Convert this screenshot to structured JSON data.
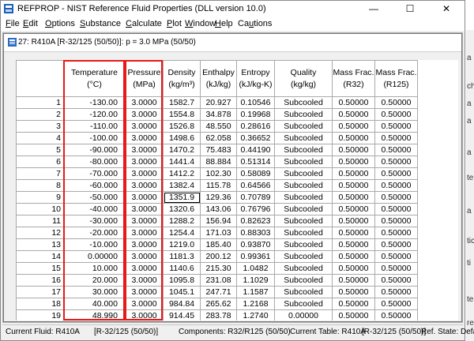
{
  "app": {
    "title": "REFPROP - NIST Reference Fluid Properties (DLL version 10.0)",
    "window_controls": {
      "minimize": "—",
      "maximize": "☐",
      "close": "✕"
    }
  },
  "menu": [
    {
      "pre": "",
      "key": "F",
      "post": "ile"
    },
    {
      "pre": "",
      "key": "E",
      "post": "dit"
    },
    {
      "pre": "",
      "key": "O",
      "post": "ptions"
    },
    {
      "pre": "",
      "key": "S",
      "post": "ubstance"
    },
    {
      "pre": "",
      "key": "C",
      "post": "alculate"
    },
    {
      "pre": "",
      "key": "P",
      "post": "lot"
    },
    {
      "pre": "",
      "key": "W",
      "post": "indow"
    },
    {
      "pre": "",
      "key": "H",
      "post": "elp"
    },
    {
      "pre": "Ca",
      "key": "u",
      "post": "tions"
    }
  ],
  "child_window": {
    "title": "27: R410A   [R-32/125 (50/50)]: p = 3.0 MPa (50/50)"
  },
  "table": {
    "columns": [
      {
        "line1": "Temperature",
        "line2": "(°C)"
      },
      {
        "line1": "Pressure",
        "line2": "(MPa)"
      },
      {
        "line1": "Density",
        "line2": "(kg/m³)"
      },
      {
        "line1": "Enthalpy",
        "line2": "(kJ/kg)"
      },
      {
        "line1": "Entropy",
        "line2": "(kJ/kg-K)"
      },
      {
        "line1": "Quality",
        "line2": "(kg/kg)"
      },
      {
        "line1": "Mass Frac.",
        "line2": "(R32)"
      },
      {
        "line1": "Mass Frac.",
        "line2": "(R125)"
      }
    ],
    "rows": [
      [
        "1",
        "-130.00",
        "3.0000",
        "1582.7",
        "20.927",
        "0.10546",
        "Subcooled",
        "0.50000",
        "0.50000"
      ],
      [
        "2",
        "-120.00",
        "3.0000",
        "1554.8",
        "34.878",
        "0.19968",
        "Subcooled",
        "0.50000",
        "0.50000"
      ],
      [
        "3",
        "-110.00",
        "3.0000",
        "1526.8",
        "48.550",
        "0.28616",
        "Subcooled",
        "0.50000",
        "0.50000"
      ],
      [
        "4",
        "-100.00",
        "3.0000",
        "1498.6",
        "62.058",
        "0.36652",
        "Subcooled",
        "0.50000",
        "0.50000"
      ],
      [
        "5",
        "-90.000",
        "3.0000",
        "1470.2",
        "75.483",
        "0.44190",
        "Subcooled",
        "0.50000",
        "0.50000"
      ],
      [
        "6",
        "-80.000",
        "3.0000",
        "1441.4",
        "88.884",
        "0.51314",
        "Subcooled",
        "0.50000",
        "0.50000"
      ],
      [
        "7",
        "-70.000",
        "3.0000",
        "1412.2",
        "102.30",
        "0.58089",
        "Subcooled",
        "0.50000",
        "0.50000"
      ],
      [
        "8",
        "-60.000",
        "3.0000",
        "1382.4",
        "115.78",
        "0.64566",
        "Subcooled",
        "0.50000",
        "0.50000"
      ],
      [
        "9",
        "-50.000",
        "3.0000",
        "1351.9",
        "129.36",
        "0.70789",
        "Subcooled",
        "0.50000",
        "0.50000"
      ],
      [
        "10",
        "-40.000",
        "3.0000",
        "1320.6",
        "143.06",
        "0.76796",
        "Subcooled",
        "0.50000",
        "0.50000"
      ],
      [
        "11",
        "-30.000",
        "3.0000",
        "1288.2",
        "156.94",
        "0.82623",
        "Subcooled",
        "0.50000",
        "0.50000"
      ],
      [
        "12",
        "-20.000",
        "3.0000",
        "1254.4",
        "171.03",
        "0.88303",
        "Subcooled",
        "0.50000",
        "0.50000"
      ],
      [
        "13",
        "-10.000",
        "3.0000",
        "1219.0",
        "185.40",
        "0.93870",
        "Subcooled",
        "0.50000",
        "0.50000"
      ],
      [
        "14",
        "0.00000",
        "3.0000",
        "1181.3",
        "200.12",
        "0.99361",
        "Subcooled",
        "0.50000",
        "0.50000"
      ],
      [
        "15",
        "10.000",
        "3.0000",
        "1140.6",
        "215.30",
        "1.0482",
        "Subcooled",
        "0.50000",
        "0.50000"
      ],
      [
        "16",
        "20.000",
        "3.0000",
        "1095.8",
        "231.08",
        "1.1029",
        "Subcooled",
        "0.50000",
        "0.50000"
      ],
      [
        "17",
        "30.000",
        "3.0000",
        "1045.1",
        "247.71",
        "1.1587",
        "Subcooled",
        "0.50000",
        "0.50000"
      ],
      [
        "18",
        "40.000",
        "3.0000",
        "984.84",
        "265.62",
        "1.2168",
        "Subcooled",
        "0.50000",
        "0.50000"
      ],
      [
        "19",
        "48.990",
        "3.0000",
        "914.45",
        "283.78",
        "1.2740",
        "0.00000",
        "0.50000",
        "0.50000"
      ]
    ]
  },
  "status": {
    "current_fluid": "Current Fluid: R410A",
    "fluid_mix": "[R-32/125 (50/50)]",
    "components": "Components: R32/R125 (50/50)",
    "current_table": "Current Table: R410A",
    "table_mix": "[R-32/125 (50/50)]",
    "ref_state": "Ref. State: Default"
  },
  "desktop_fragments": [
    "a",
    "ch",
    "a",
    "a",
    "a",
    "te",
    "a",
    "tic",
    "ti",
    "te",
    "re"
  ],
  "colors": {
    "highlight": "#e81818",
    "grid_line": "#a9a9a9"
  }
}
